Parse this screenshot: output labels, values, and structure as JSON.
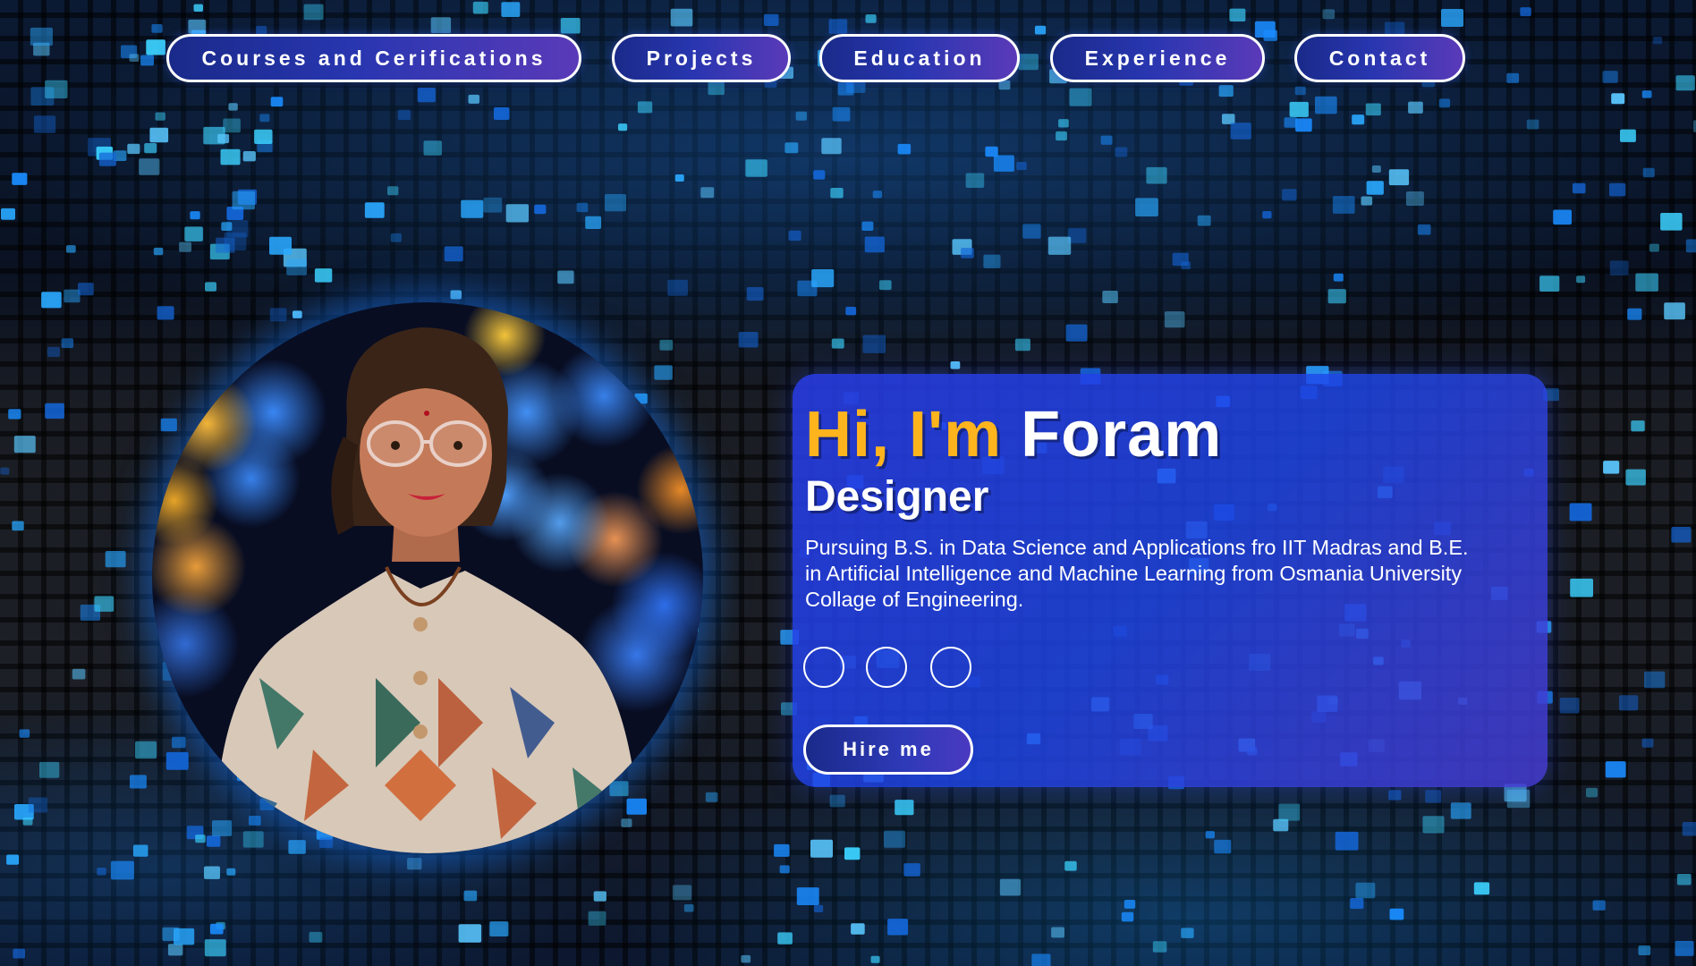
{
  "nav": {
    "items": [
      {
        "label": "Courses and Cerifications"
      },
      {
        "label": "Projects"
      },
      {
        "label": "Education"
      },
      {
        "label": "Experience"
      },
      {
        "label": "Contact"
      }
    ]
  },
  "hero": {
    "greeting_prefix": "Hi, I'm",
    "name": "Foram",
    "role": "Designer",
    "bio": "Pursuing B.S. in Data Science and Applications fro IIT Madras and B.E. in Artificial Intelligence and Machine Learning from Osmania University Collage of Engineering.",
    "social_links": [
      {
        "icon": "social-link-icon"
      },
      {
        "icon": "social-link-icon"
      },
      {
        "icon": "social-link-icon"
      }
    ],
    "cta_label": "Hire me"
  },
  "colors": {
    "accent": "#ffb41e",
    "card": "#2a40e6",
    "button": "#2836b0"
  }
}
